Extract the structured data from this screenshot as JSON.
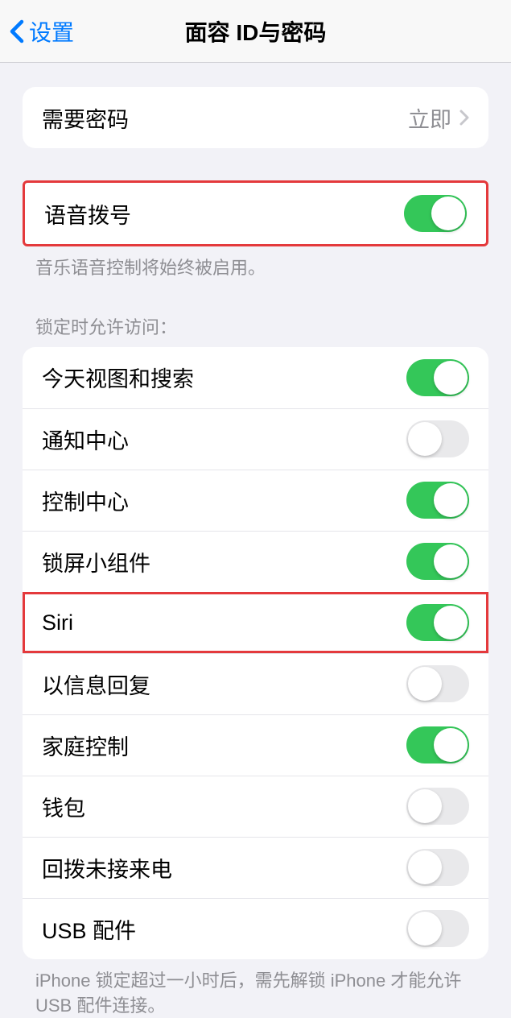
{
  "nav": {
    "back_label": "设置",
    "title": "面容 ID与密码"
  },
  "require_passcode": {
    "label": "需要密码",
    "value": "立即"
  },
  "voice_dial": {
    "label": "语音拨号",
    "on": true,
    "footer": "音乐语音控制将始终被启用。"
  },
  "lock_access": {
    "header": "锁定时允许访问：",
    "items": [
      {
        "label": "今天视图和搜索",
        "on": true
      },
      {
        "label": "通知中心",
        "on": false
      },
      {
        "label": "控制中心",
        "on": true
      },
      {
        "label": "锁屏小组件",
        "on": true
      },
      {
        "label": "Siri",
        "on": true
      },
      {
        "label": "以信息回复",
        "on": false
      },
      {
        "label": "家庭控制",
        "on": true
      },
      {
        "label": "钱包",
        "on": false
      },
      {
        "label": "回拨未接来电",
        "on": false
      },
      {
        "label": "USB 配件",
        "on": false
      }
    ],
    "footer": "iPhone 锁定超过一小时后，需先解锁 iPhone 才能允许USB 配件连接。"
  }
}
